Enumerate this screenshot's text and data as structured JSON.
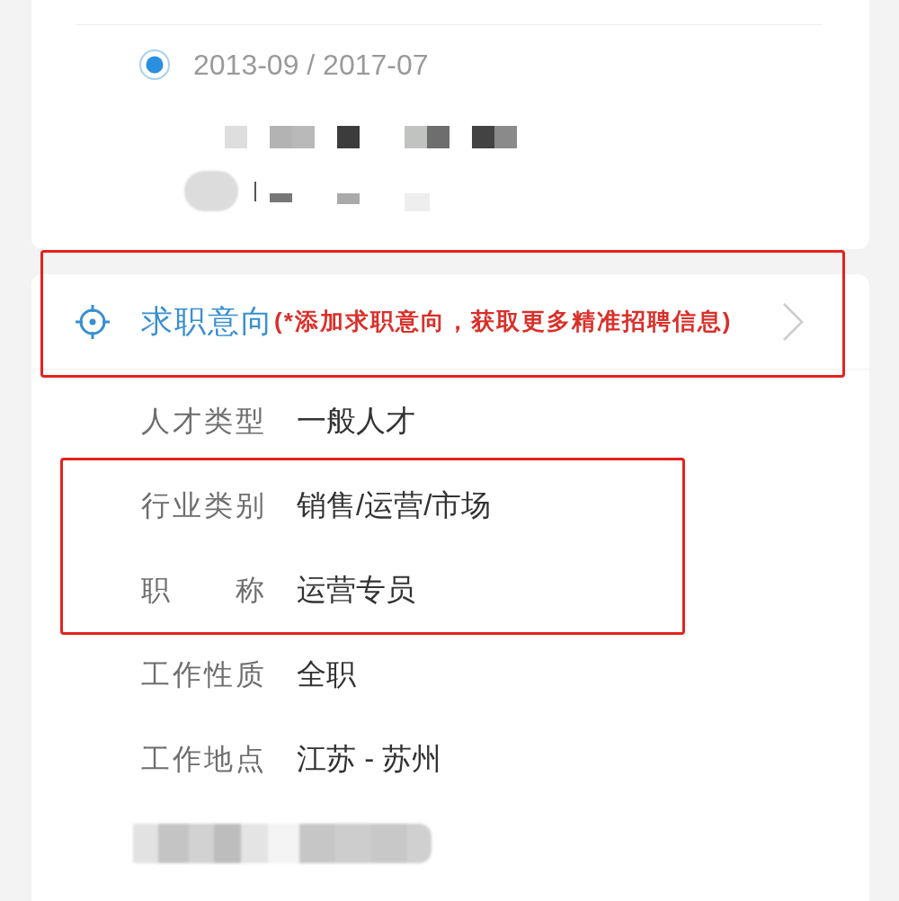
{
  "education": {
    "selected": true,
    "period": "2013-09 / 2017-07"
  },
  "job_intention": {
    "title": "求职意向",
    "hint": "(*添加求职意向，获取更多精准招聘信息)",
    "highlighted": true
  },
  "fields": [
    {
      "label": "人才类型",
      "value": "一般人才",
      "highlighted": false
    },
    {
      "label": "行业类别",
      "value": "销售/运营/市场",
      "highlighted": true
    },
    {
      "label": "职 称",
      "value": "运营专员",
      "highlighted": true
    },
    {
      "label": "工作性质",
      "value": "全职",
      "highlighted": false
    },
    {
      "label": "工作地点",
      "value": "江苏 - 苏州",
      "highlighted": false
    }
  ]
}
